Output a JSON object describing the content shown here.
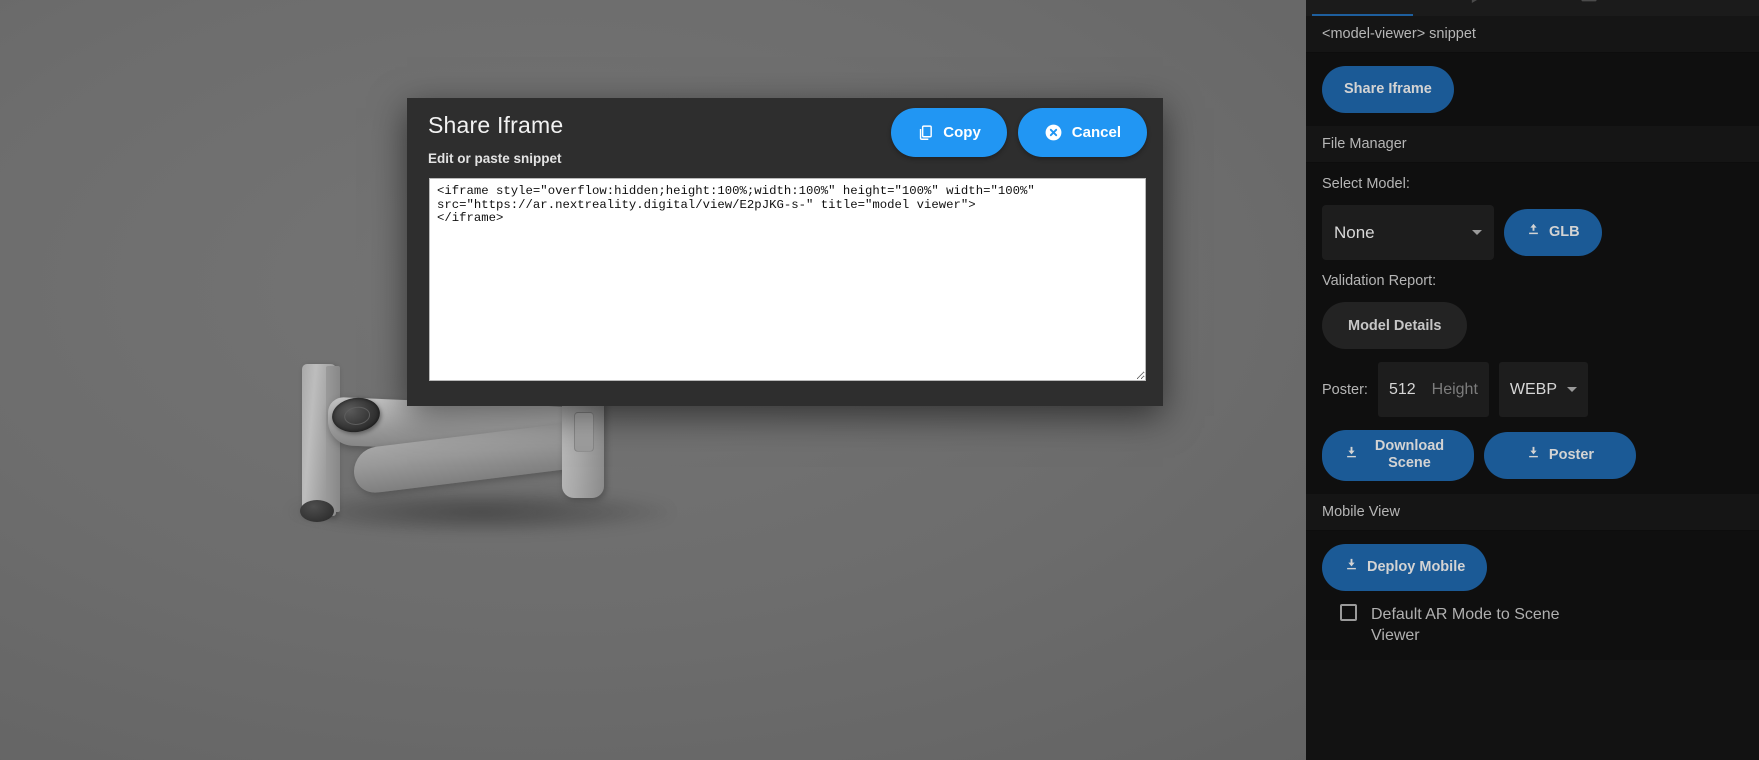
{
  "modal": {
    "title": "Share Iframe",
    "subtitle": "Edit or paste snippet",
    "copy_label": "Copy",
    "cancel_label": "Cancel",
    "snippet": "<iframe style=\"overflow:hidden;height:100%;width:100%\" height=\"100%\" width=\"100%\"\nsrc=\"https://ar.nextreality.digital/view/E2pJKG-s-\" title=\"model viewer\">\n</iframe>"
  },
  "sidebar": {
    "tabs": [
      {
        "name": "model-tab",
        "icon": "cube-icon",
        "active": true
      },
      {
        "name": "animation-tab",
        "icon": "play-icon",
        "active": false
      },
      {
        "name": "scene-tab",
        "icon": "image-icon",
        "active": false
      },
      {
        "name": "tools-tab",
        "icon": "wrench-icon",
        "active": false
      }
    ],
    "snippet_section": {
      "label": "<model-viewer> snippet",
      "share_iframe_label": "Share Iframe"
    },
    "file_manager": {
      "label": "File Manager",
      "select_model_label": "Select Model:",
      "select_model_value": "None",
      "upload_glb_label": "GLB",
      "validation_report_label": "Validation Report:",
      "model_details_label": "Model Details",
      "poster_label": "Poster:",
      "poster_width": "512",
      "poster_height_placeholder": "Height",
      "poster_format": "WEBP",
      "download_scene_label": "Download Scene",
      "download_poster_label": "Poster"
    },
    "mobile_view": {
      "label": "Mobile View",
      "deploy_mobile_label": "Deploy Mobile",
      "default_ar_label": "Default AR Mode to Scene Viewer",
      "default_ar_checked": false
    }
  },
  "colors": {
    "accent_blue": "#2196f3",
    "panel_blue": "#1b5a96",
    "sidebar_bg": "#121212",
    "modal_bg": "#2e2e2e",
    "viewport_bg": "#6a6a6a"
  }
}
